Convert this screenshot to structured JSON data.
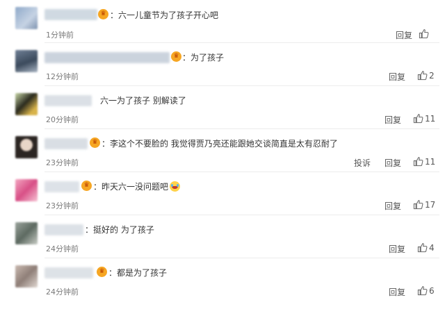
{
  "comments": [
    {
      "text": "：六一儿童节为了孩子开心吧",
      "time": "1分钟前",
      "reply": "回复",
      "report": "",
      "likes": ""
    },
    {
      "text": "：为了孩子",
      "time": "12分钟前",
      "reply": "回复",
      "report": "",
      "likes": "2"
    },
    {
      "text": "六一为了孩子 别解读了",
      "time": "20分钟前",
      "reply": "回复",
      "report": "",
      "likes": "11"
    },
    {
      "text": "：李这个不要脸的 我觉得贾乃亮还能跟她交谈简直是太有忍耐了",
      "time": "23分钟前",
      "reply": "回复",
      "report": "投诉",
      "likes": "11"
    },
    {
      "text": "：昨天六一没问题吧",
      "time": "23分钟前",
      "reply": "回复",
      "report": "",
      "likes": "17"
    },
    {
      "text": "：挺好的 为了孩子",
      "time": "24分钟前",
      "reply": "回复",
      "report": "",
      "likes": "4"
    },
    {
      "text": "：都是为了孩子",
      "time": "24分钟前",
      "reply": "回复",
      "report": "",
      "likes": "6"
    }
  ],
  "icons": {
    "like": "thumbs-up-icon",
    "crown": "vip-crown-icon",
    "emoji": "laugh-cry-emoji"
  },
  "colors": {
    "text": "#333333",
    "meta": "#7a7a7a",
    "divider": "#ececec",
    "crown": "#f6a623"
  }
}
